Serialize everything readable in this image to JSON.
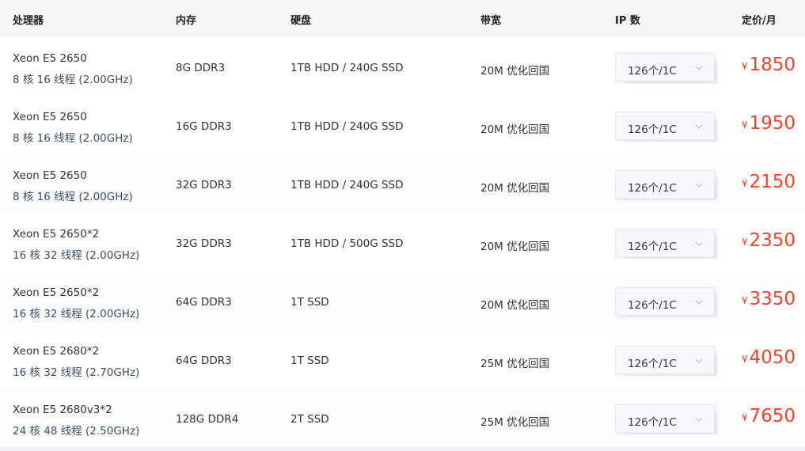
{
  "header": {
    "cpu": "处理器",
    "memory": "内存",
    "disk": "硬盘",
    "bandwidth": "带宽",
    "ip": "IP 数",
    "price": "定价/月"
  },
  "currency": "¥",
  "colors": {
    "price": "#f2442d",
    "spec": "#3c4d68",
    "header_bg": "#f4f5f7"
  },
  "rows": [
    {
      "cpu": "Xeon E5 2650",
      "spec": "8 核 16 线程 (2.00GHz)",
      "memory": "8G DDR3",
      "disk": "1TB HDD / 240G SSD",
      "bandwidth": "20M 优化回国",
      "ip": "126个/1C",
      "price": "1850"
    },
    {
      "cpu": "Xeon E5 2650",
      "spec": "8 核 16 线程 (2.00GHz)",
      "memory": "16G DDR3",
      "disk": "1TB HDD / 240G SSD",
      "bandwidth": "20M 优化回国",
      "ip": "126个/1C",
      "price": "1950"
    },
    {
      "cpu": "Xeon E5 2650",
      "spec": "8 核 16 线程 (2.00GHz)",
      "memory": "32G DDR3",
      "disk": "1TB HDD / 240G SSD",
      "bandwidth": "20M 优化回国",
      "ip": "126个/1C",
      "price": "2150"
    },
    {
      "cpu": "Xeon E5 2650*2",
      "spec": "16 核 32 线程 (2.00GHz)",
      "memory": "32G DDR3",
      "disk": "1TB HDD / 500G SSD",
      "bandwidth": "20M 优化回国",
      "ip": "126个/1C",
      "price": "2350"
    },
    {
      "cpu": "Xeon E5 2650*2",
      "spec": "16 核 32 线程 (2.00GHz)",
      "memory": "64G DDR3",
      "disk": "1T SSD",
      "bandwidth": "20M 优化回国",
      "ip": "126个/1C",
      "price": "3350"
    },
    {
      "cpu": "Xeon E5 2680*2",
      "spec": "16 核 32 线程 (2.70GHz)",
      "memory": "64G DDR3",
      "disk": "1T SSD",
      "bandwidth": "25M 优化回国",
      "ip": "126个/1C",
      "price": "4050"
    },
    {
      "cpu": "Xeon E5 2680v3*2",
      "spec": "24 核 48 线程 (2.50GHz)",
      "memory": "128G DDR4",
      "disk": "2T SSD",
      "bandwidth": "25M 优化回国",
      "ip": "126个/1C",
      "price": "7650"
    }
  ]
}
